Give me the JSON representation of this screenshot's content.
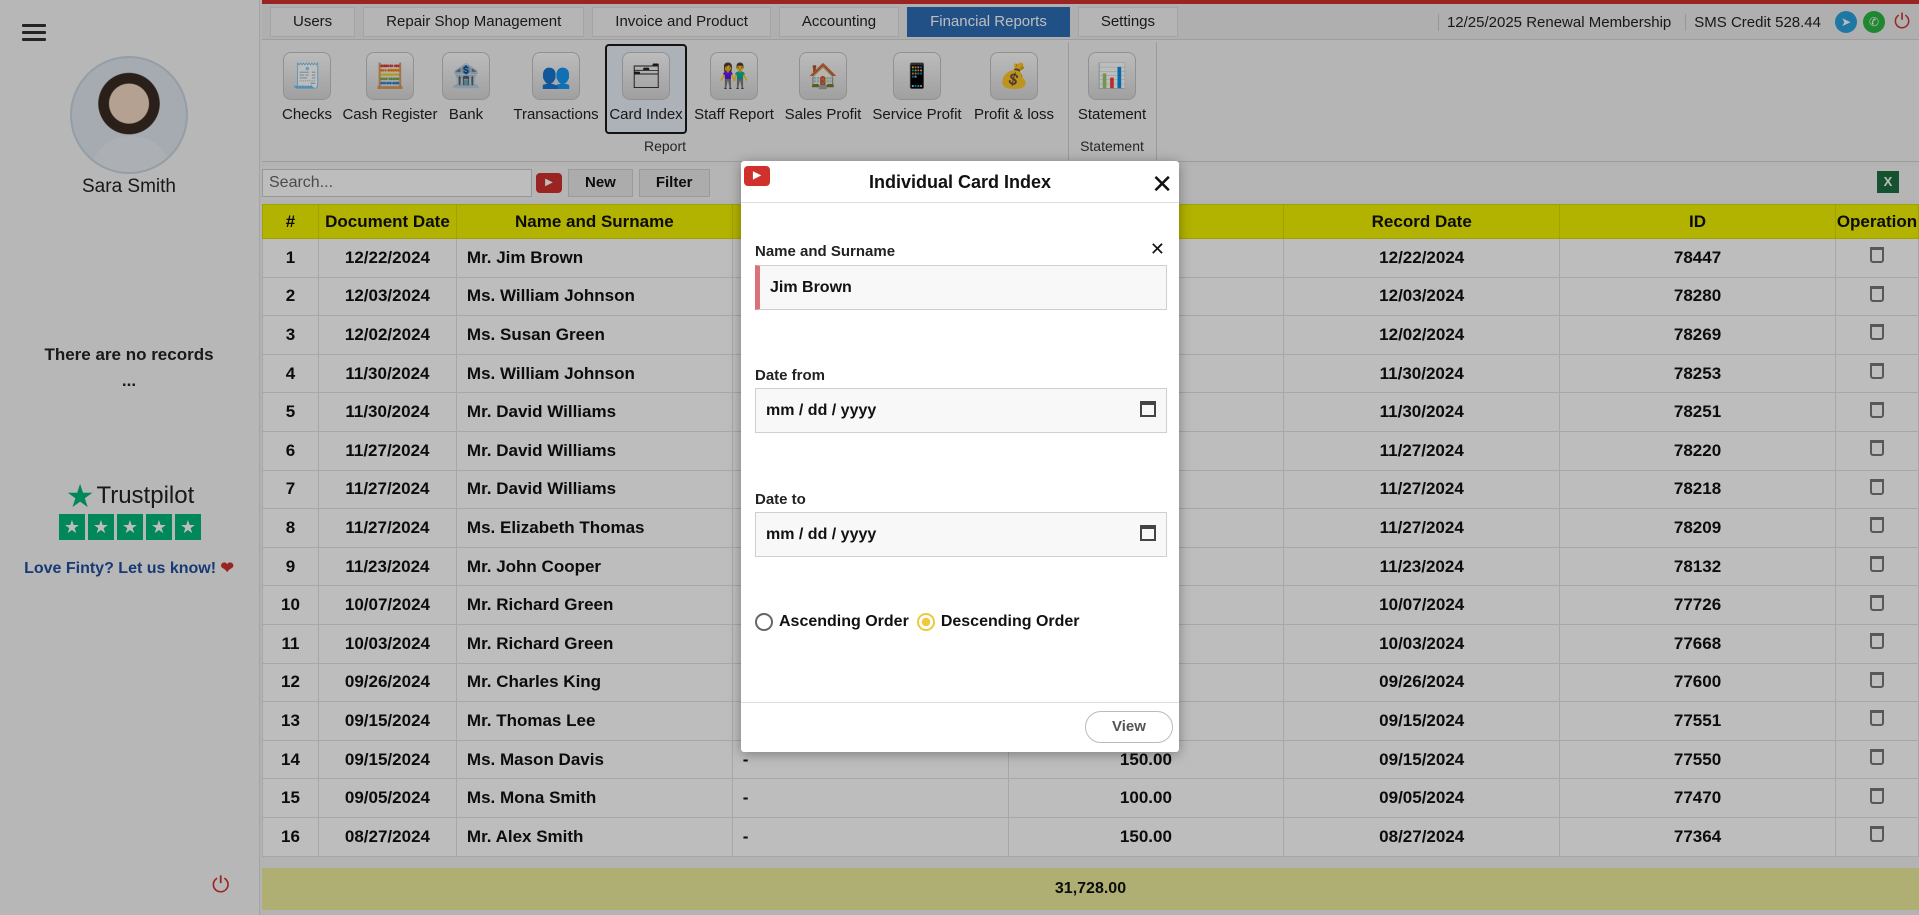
{
  "sidebar": {
    "user_name": "Sara Smith",
    "no_records": "There are no records",
    "no_records_dots": "...",
    "trustpilot": "Trustpilot",
    "love": "Love Finty? Let us know!"
  },
  "nav": {
    "tabs": [
      "Users",
      "Repair Shop Management",
      "Invoice and Product",
      "Accounting",
      "Financial Reports",
      "Settings"
    ],
    "active_tab": "Financial Reports",
    "renewal": "12/25/2025 Renewal Membership",
    "sms": "SMS Credit 528.44"
  },
  "ribbon": {
    "items": [
      "Checks",
      "Cash Register",
      "Bank",
      "Transactions",
      "Card Index",
      "Staff Report",
      "Sales Profit",
      "Service Profit",
      "Profit & loss",
      "Statement"
    ],
    "selected": "Card Index",
    "group_report": "Report",
    "group_statement": "Statement"
  },
  "toolbar": {
    "search_placeholder": "Search...",
    "new_label": "New",
    "filter_label": "Filter"
  },
  "table": {
    "headers": [
      "#",
      "Document Date",
      "Name and Surname",
      "",
      "",
      "Record Date",
      "ID",
      "Operation"
    ],
    "rows": [
      [
        "1",
        "12/22/2024",
        "Mr. Jim Brown",
        "",
        "",
        "12/22/2024",
        "78447"
      ],
      [
        "2",
        "12/03/2024",
        "Ms. William Johnson",
        "",
        "",
        "12/03/2024",
        "78280"
      ],
      [
        "3",
        "12/02/2024",
        "Ms. Susan Green",
        "",
        "",
        "12/02/2024",
        "78269"
      ],
      [
        "4",
        "11/30/2024",
        "Ms. William Johnson",
        "",
        "",
        "11/30/2024",
        "78253"
      ],
      [
        "5",
        "11/30/2024",
        "Mr. David Williams",
        "",
        "",
        "11/30/2024",
        "78251"
      ],
      [
        "6",
        "11/27/2024",
        "Mr. David Williams",
        "",
        "",
        "11/27/2024",
        "78220"
      ],
      [
        "7",
        "11/27/2024",
        "Mr. David Williams",
        "",
        "",
        "11/27/2024",
        "78218"
      ],
      [
        "8",
        "11/27/2024",
        "Ms. Elizabeth Thomas",
        "",
        "",
        "11/27/2024",
        "78209"
      ],
      [
        "9",
        "11/23/2024",
        "Mr. John Cooper",
        "",
        "",
        "11/23/2024",
        "78132"
      ],
      [
        "10",
        "10/07/2024",
        "Mr. Richard Green",
        "",
        "",
        "10/07/2024",
        "77726"
      ],
      [
        "11",
        "10/03/2024",
        "Mr. Richard Green",
        "",
        "",
        "10/03/2024",
        "77668"
      ],
      [
        "12",
        "09/26/2024",
        "Mr. Charles King",
        "",
        "",
        "09/26/2024",
        "77600"
      ],
      [
        "13",
        "09/15/2024",
        "Mr. Thomas Lee",
        "",
        "",
        "09/15/2024",
        "77551"
      ],
      [
        "14",
        "09/15/2024",
        "Ms. Mason Davis",
        "-",
        "150.00",
        "09/15/2024",
        "77550"
      ],
      [
        "15",
        "09/05/2024",
        "Ms. Mona Smith",
        "-",
        "100.00",
        "09/05/2024",
        "77470"
      ],
      [
        "16",
        "08/27/2024",
        "Mr. Alex Smith",
        "-",
        "150.00",
        "08/27/2024",
        "77364"
      ]
    ],
    "total": "31,728.00"
  },
  "modal": {
    "title": "Individual Card Index",
    "name_label": "Name and Surname",
    "name_value": "Jim Brown",
    "date_from_label": "Date from",
    "date_from_value": "mm / dd / yyyy",
    "date_to_label": "Date to",
    "date_to_value": "mm / dd / yyyy",
    "ascending": "Ascending Order",
    "descending": "Descending Order",
    "order_selected": "Descending Order",
    "view_label": "View"
  }
}
